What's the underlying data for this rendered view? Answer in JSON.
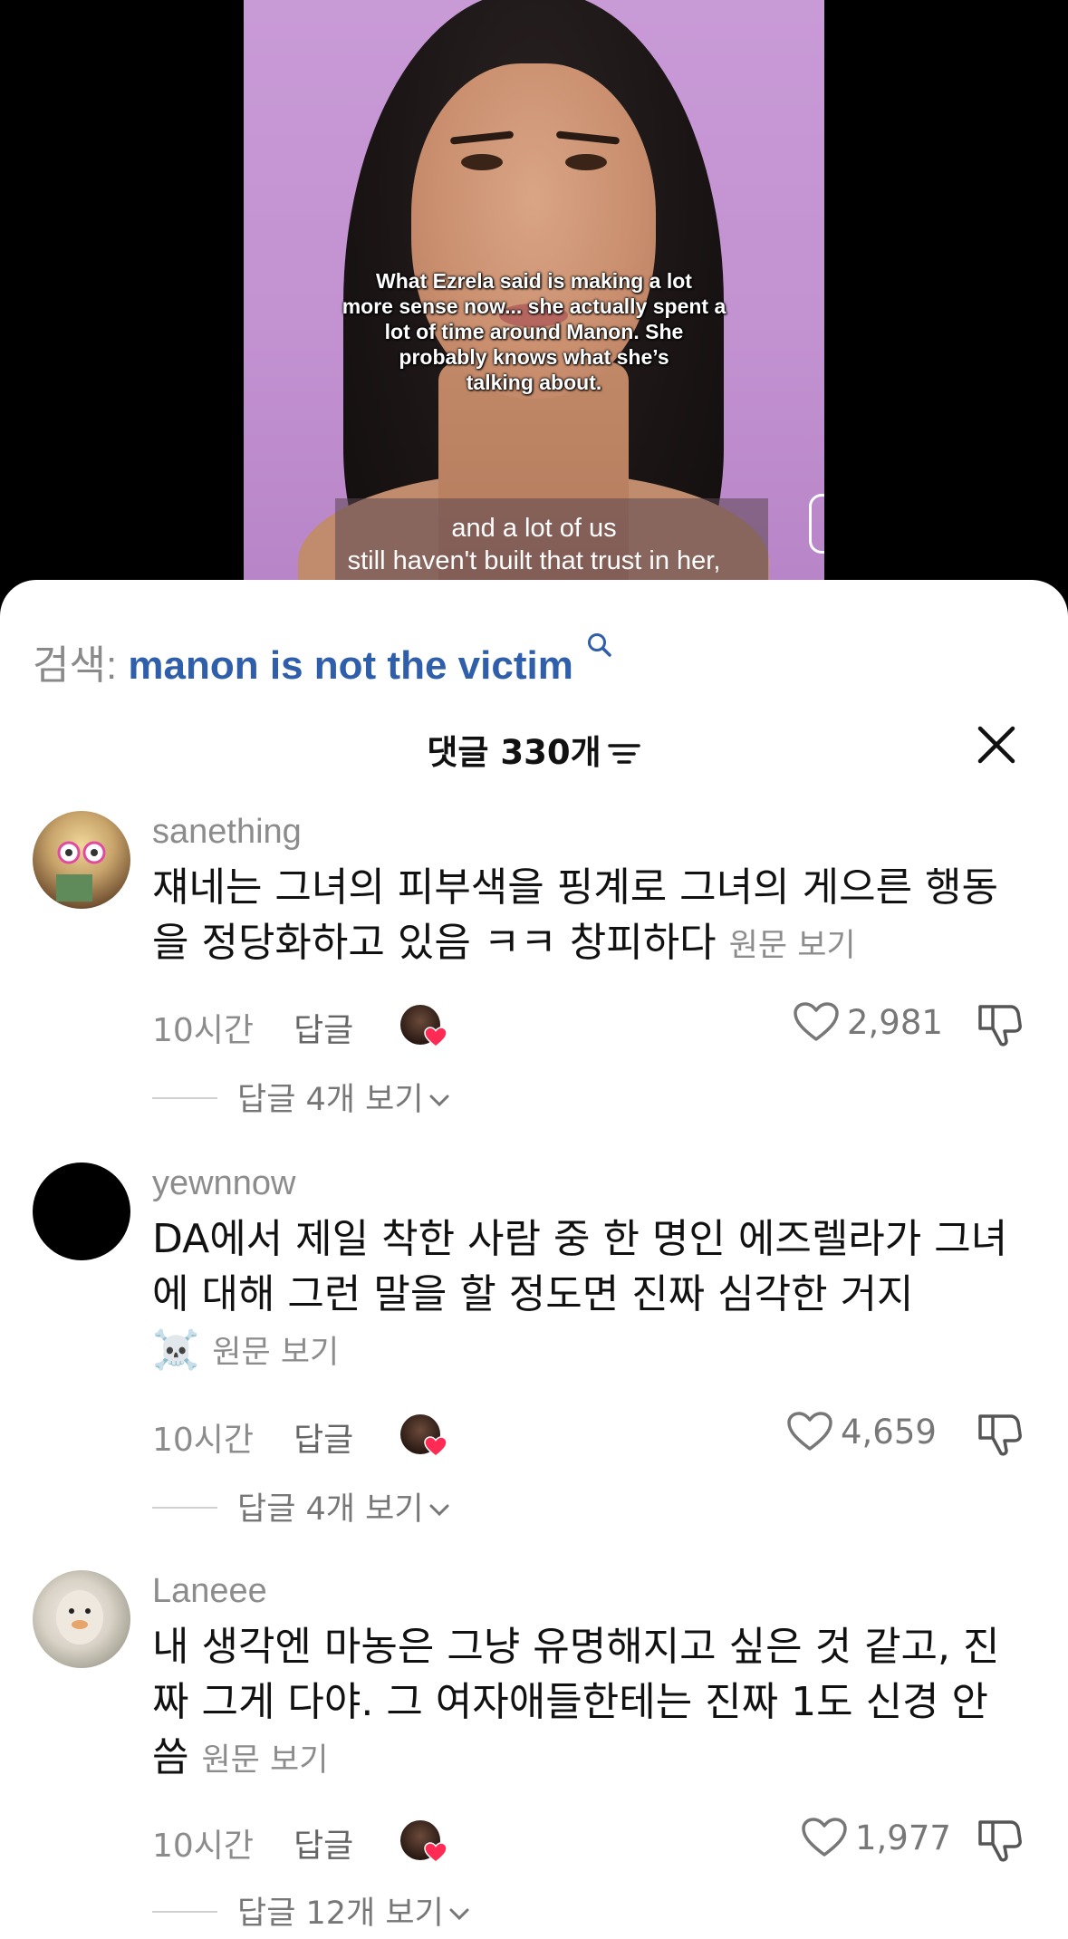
{
  "video": {
    "overlay_text": "What Ezrela said is making a lot\nmore sense now... she actually spent a\nlot of time around Manon. She\nprobably knows what she’s\ntalking about.",
    "caption": "and a lot of us\nstill haven't built that trust in her,"
  },
  "search": {
    "prefix": "검색:",
    "term": "manon is not the victim"
  },
  "header": {
    "title": "댓글 330개"
  },
  "comments": [
    {
      "username": "sanething",
      "text": "쟤네는 그녀의 피부색을 핑계로 그녀의 게으른 행동을 정당화하고 있음 ㅋㅋ 창피하다",
      "translate": "원문 보기",
      "time": "10시간",
      "reply": "답글",
      "likes": "2,981",
      "view_replies": "답글 4개 보기"
    },
    {
      "username": "yewnnow",
      "text": "DA에서 제일 착한 사람 중 한 명인 에즈렐라가 그녀에 대해 그런 말을 할 정도면 진짜 심각한 거지",
      "emoji": "☠️",
      "translate": "원문 보기",
      "time": "10시간",
      "reply": "답글",
      "likes": "4,659",
      "view_replies": "답글 4개 보기"
    },
    {
      "username": "Laneee",
      "text": "내 생각엔 마농은 그냥 유명해지고 싶은 것 같고, 진짜 그게 다야. 그 여자애들한테는 진짜 1도 신경 안 씀",
      "translate": "원문 보기",
      "time": "10시간",
      "reply": "답글",
      "likes": "1,977",
      "view_replies": "답글 12개 보기"
    }
  ],
  "colors": {
    "search_term": "#2f5eab",
    "creator_heart": "#fe2c55",
    "muted_text": "#8c8c8c"
  },
  "icons": [
    "search-icon",
    "sort-icon",
    "close-icon",
    "heart-icon",
    "dislike-icon",
    "chevron-down-icon"
  ]
}
